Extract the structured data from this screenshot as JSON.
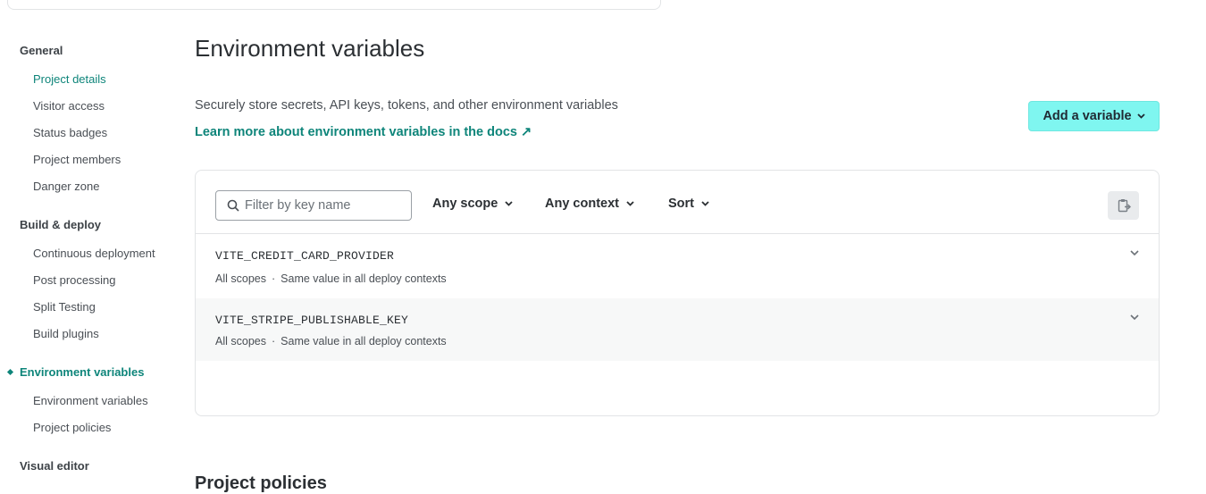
{
  "sidebar": {
    "sections": [
      {
        "title": "General",
        "items": [
          "Project details",
          "Visitor access",
          "Status badges",
          "Project members",
          "Danger zone"
        ]
      },
      {
        "title": "Build & deploy",
        "items": [
          "Continuous deployment",
          "Post processing",
          "Split Testing",
          "Build plugins"
        ]
      },
      {
        "title": "Environment variables",
        "items": [
          "Environment variables",
          "Project policies"
        ]
      },
      {
        "title": "Visual editor",
        "items": []
      }
    ]
  },
  "main": {
    "title": "Environment variables",
    "subtitle": "Securely store secrets, API keys, tokens, and other environment variables",
    "docs_link": "Learn more about environment variables in the docs ↗",
    "add_button": "Add a variable",
    "search_placeholder": "Filter by key name",
    "filters": {
      "scope": "Any scope",
      "context": "Any context",
      "sort": "Sort"
    },
    "variables": [
      {
        "key": "VITE_CREDIT_CARD_PROVIDER",
        "scope": "All scopes",
        "context": "Same value in all deploy contexts"
      },
      {
        "key": "VITE_STRIPE_PUBLISHABLE_KEY",
        "scope": "All scopes",
        "context": "Same value in all deploy contexts"
      }
    ],
    "next_section_title": "Project policies"
  },
  "colors": {
    "accent": "#0e857a",
    "button_bg": "#7ff6f0"
  },
  "icons": {
    "search": "search-icon",
    "chevron": "chevron-down-icon",
    "clipboard": "clipboard-icon",
    "external": "external-link-icon"
  }
}
